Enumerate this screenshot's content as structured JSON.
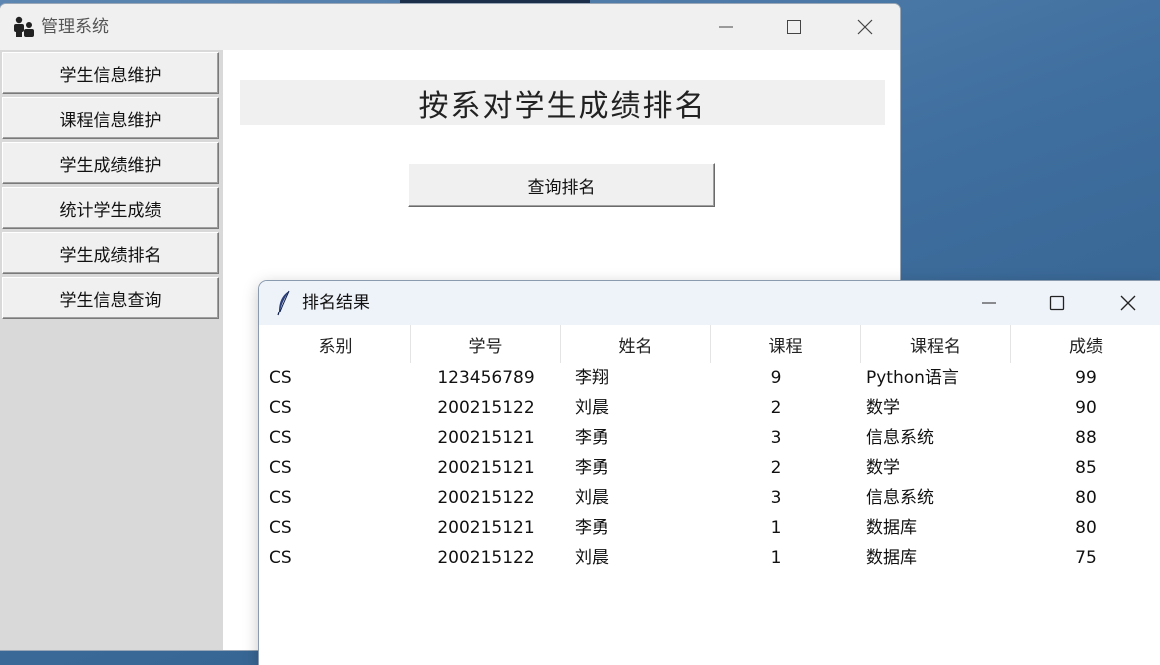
{
  "main_window": {
    "title": "管理系统",
    "icon": "users-icon"
  },
  "sidebar": {
    "items": [
      {
        "label": "学生信息维护"
      },
      {
        "label": "课程信息维护"
      },
      {
        "label": "学生成绩维护"
      },
      {
        "label": "统计学生成绩"
      },
      {
        "label": "学生成绩排名"
      },
      {
        "label": "学生信息查询"
      }
    ]
  },
  "content": {
    "heading": "按系对学生成绩排名",
    "query_button": "查询排名"
  },
  "result_window": {
    "title": "排名结果",
    "icon": "feather-icon",
    "columns": [
      "系别",
      "学号",
      "姓名",
      "课程",
      "课程名",
      "成绩"
    ],
    "rows": [
      [
        "CS",
        "123456789",
        "李翔",
        "9",
        "Python语言",
        "99"
      ],
      [
        "CS",
        "200215122",
        "刘晨",
        "2",
        "数学",
        "90"
      ],
      [
        "CS",
        "200215121",
        "李勇",
        "3",
        "信息系统",
        "88"
      ],
      [
        "CS",
        "200215121",
        "李勇",
        "2",
        "数学",
        "85"
      ],
      [
        "CS",
        "200215122",
        "刘晨",
        "3",
        "信息系统",
        "80"
      ],
      [
        "CS",
        "200215121",
        "李勇",
        "1",
        "数据库",
        "80"
      ],
      [
        "CS",
        "200215122",
        "刘晨",
        "1",
        "数据库",
        "75"
      ]
    ]
  }
}
